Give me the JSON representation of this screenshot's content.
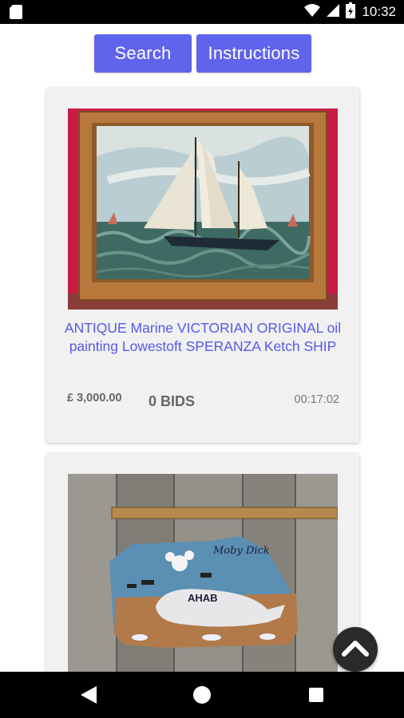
{
  "status_bar": {
    "time": "10:32",
    "icons": [
      "sd-card-icon",
      "wifi-icon",
      "cell-signal-icon",
      "battery-icon"
    ]
  },
  "toolbar": {
    "search_label": "Search",
    "instructions_label": "Instructions",
    "button_color": "#6064ec"
  },
  "listings": [
    {
      "image_desc": "oil painting of a sailing ketch in a wooden frame",
      "title": "ANTIQUE Marine VICTORIAN ORIGINAL oil painting Lowestoft SPERANZA Ketch SHIP",
      "price": "£ 3,000.00",
      "bids": "0 BIDS",
      "time_left": "00:17:02"
    },
    {
      "image_desc": "painted wooden sign with a whale named AHAB on weathered planks",
      "sign_text_top": "Moby Dick",
      "sign_text_whale": "AHAB"
    }
  ],
  "nav": {
    "icons": [
      "back-icon",
      "home-icon",
      "recents-icon"
    ]
  },
  "colors": {
    "title_link": "#5659e6",
    "card_bg": "#f1f1f1"
  }
}
